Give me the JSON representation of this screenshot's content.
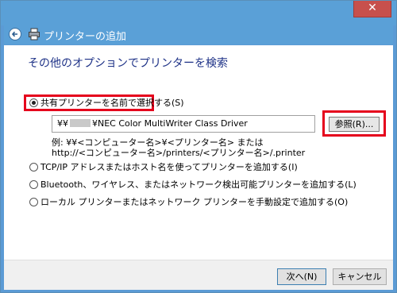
{
  "window": {
    "close_glyph": "✕"
  },
  "nav": {
    "title": "プリンターの追加"
  },
  "main": {
    "heading": "その他のオプションでプリンターを検索",
    "options": [
      {
        "label": "共有プリンターを名前で選択する(S)",
        "checked": true
      },
      {
        "label": "TCP/IP アドレスまたはホスト名を使ってプリンターを追加する(I)",
        "checked": false
      },
      {
        "label": "Bluetooth、ワイヤレス、またはネットワーク検出可能プリンターを追加する(L)",
        "checked": false
      },
      {
        "label": "ローカル プリンターまたはネットワーク プリンターを手動設定で追加する(O)",
        "checked": false
      }
    ],
    "path_prefix": "¥¥",
    "path_suffix": "¥NEC Color MultiWriter Class Driver",
    "browse_label": "参照(R)...",
    "example_line1": "例: ¥¥<コンピューター名>¥<プリンター名> または",
    "example_line2": "http://<コンピューター名>/printers/<プリンター名>/.printer"
  },
  "footer": {
    "next_label": "次へ(N)",
    "cancel_label": "キャンセル"
  },
  "colors": {
    "titlebar": "#5aa0d7",
    "close": "#c7504c",
    "heading": "#1e3287",
    "highlight": "#e5001c"
  },
  "icons": [
    "close-icon",
    "back-arrow-icon",
    "printer-icon"
  ]
}
